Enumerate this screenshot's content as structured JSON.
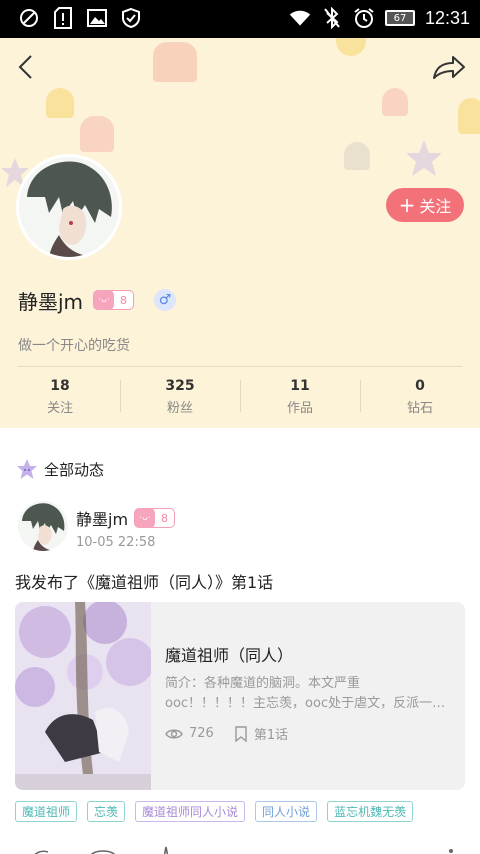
{
  "status_bar": {
    "time": "12:31",
    "battery": "67",
    "icons": [
      "block-icon",
      "sim-alert-icon",
      "image-icon",
      "shield-check-icon",
      "wifi-icon",
      "bluetooth-off-icon",
      "alarm-icon",
      "battery-icon"
    ]
  },
  "header": {
    "back_icon": "back-chevron-icon",
    "share_icon": "share-arrow-icon",
    "follow_button": "关注",
    "username": "静墨jm",
    "level": "8",
    "gender_symbol": "♂",
    "bio": "做一个开心的吃货",
    "stats": [
      {
        "value": "18",
        "label": "关注"
      },
      {
        "value": "325",
        "label": "粉丝"
      },
      {
        "value": "11",
        "label": "作品"
      },
      {
        "value": "0",
        "label": "钻石"
      }
    ],
    "colors": {
      "background": "#fdf3d8",
      "follow": "#f3727a"
    }
  },
  "feed": {
    "section_title": "全部动态",
    "post": {
      "author": "静墨jm",
      "level": "8",
      "time": "10-05 22:58",
      "text": "我发布了《魔道祖师（同人）》第1话",
      "card": {
        "title": "魔道祖师（同人）",
        "desc_line1": "简介：各种魔道的脑洞。本文严重",
        "desc_line2": "ooc！！！！！主忘羡，ooc处于虐文，反派一…",
        "views": "726",
        "chapter": "第1话"
      },
      "tags": [
        "魔道祖师",
        "忘羡",
        "魔道祖师同人小说",
        "同人小说",
        "蓝忘机魏无羡"
      ]
    }
  }
}
